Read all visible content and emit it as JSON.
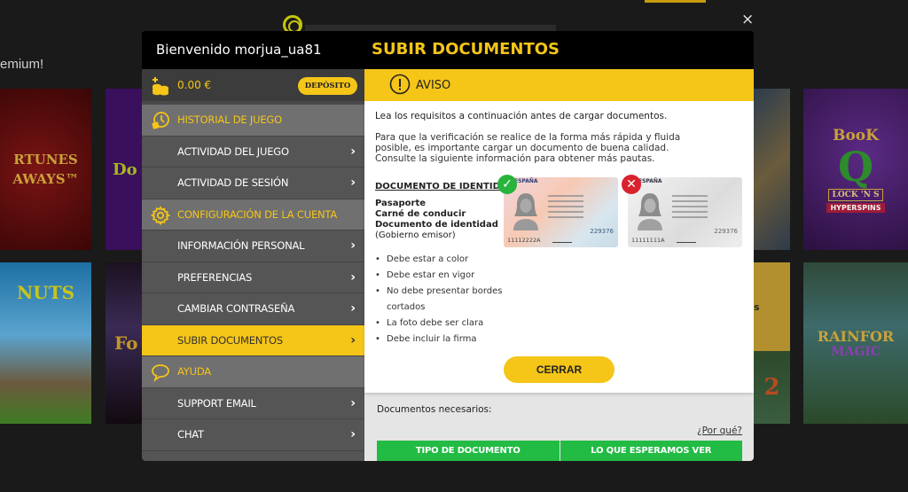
{
  "background": {
    "promo_text": "emium!",
    "tiles": [
      {
        "title_line1": "RTUNES",
        "title_line2": "AWAYS™"
      },
      {
        "title": "Do"
      },
      {
        "title": "NUTS"
      },
      {
        "title": "Fo"
      },
      {
        "title_line1": "BooK",
        "title_line2": "Q",
        "title_line3": "LOCK 'N S",
        "title_line4": "HYPERSPINS"
      },
      {
        "title": "s"
      },
      {
        "title": "2"
      },
      {
        "title_line1": "RAINFOR",
        "title_line2": "MAGIC"
      }
    ],
    "close_icon": "×"
  },
  "modal": {
    "welcome": "Bienvenido morjua_ua81",
    "section_title": "SUBIR DOCUMENTOS",
    "balance": "0.00 €",
    "deposit_label": "DEPÓSITO",
    "menu": [
      {
        "label": "HISTORIAL DE JUEGO",
        "type": "category",
        "icon": "clock-history-icon"
      },
      {
        "label": "ACTIVIDAD DEL JUEGO",
        "type": "sub"
      },
      {
        "label": "ACTIVIDAD DE SESIÓN",
        "type": "sub"
      },
      {
        "label": "CONFIGURACIÓN DE LA CUENTA",
        "type": "category",
        "icon": "gear-icon"
      },
      {
        "label": "INFORMACIÓN PERSONAL",
        "type": "sub"
      },
      {
        "label": "PREFERENCIAS",
        "type": "sub"
      },
      {
        "label": "CAMBIAR CONTRASEÑA",
        "type": "sub"
      },
      {
        "label": "SUBIR DOCUMENTOS",
        "type": "sub",
        "active": true
      },
      {
        "label": "AYUDA",
        "type": "category",
        "icon": "chat-bubble-icon"
      },
      {
        "label": "SUPPORT EMAIL",
        "type": "sub"
      },
      {
        "label": "CHAT",
        "type": "sub"
      }
    ],
    "chevron": "›",
    "notice": {
      "title": "AVISO",
      "intro": "Lea los requisitos a continuación antes de cargar documentos.",
      "paragraph": "Para que la verificación se realice de la forma más rápida y fluida posible, es importante cargar un documento de buena calidad. Consulte la siguiente información para obtener más pautas.",
      "doc_heading": "DOCUMENTO DE IDENTIDAD",
      "doc_types": [
        "Pasaporte",
        "Carné de conducir",
        "Documento de identidad"
      ],
      "doc_types_note": "(Gobierno emisor)",
      "requirements": [
        "Debe estar a color",
        "Debe estar en vigor",
        "No debe presentar bordes cortados",
        "La foto debe ser clara",
        "Debe incluir la firma"
      ],
      "example_good": {
        "header": "ESPAÑA",
        "doc_number": "11112222A",
        "code": "229376",
        "status_icon": "✓"
      },
      "example_bad": {
        "header": "ESPAÑA",
        "doc_number": "11111111A",
        "code": "229376",
        "status_icon": "✕"
      },
      "close_label": "CERRAR"
    },
    "needed_label": "Documentos necesarios:",
    "why_link": "¿Por qué?",
    "table_headers": [
      "TIPO DE DOCUMENTO",
      "LO QUE ESPERAMOS VER"
    ]
  },
  "colors": {
    "accent": "#f5c518",
    "green": "#22bb44",
    "ok": "#28b43c",
    "error": "#d8232f"
  }
}
